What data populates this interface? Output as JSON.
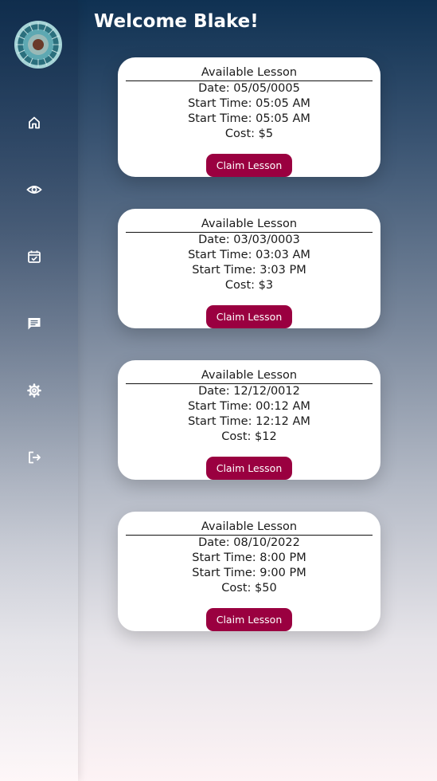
{
  "header": {
    "title": "Welcome Blake!"
  },
  "sidebar": {
    "items": [
      {
        "name": "home",
        "icon": "home-icon"
      },
      {
        "name": "view",
        "icon": "eye-icon"
      },
      {
        "name": "calendar",
        "icon": "calendar-check-icon"
      },
      {
        "name": "messages",
        "icon": "chat-icon"
      },
      {
        "name": "settings",
        "icon": "gear-icon"
      },
      {
        "name": "logout",
        "icon": "logout-icon"
      }
    ]
  },
  "colors": {
    "button": "#9a0040",
    "card": "#ffffff",
    "title": "#ffffff"
  },
  "lessons": [
    {
      "heading": "Available Lesson",
      "date": "Date: 05/05/0005",
      "start1": "Start Time: 05:05 AM",
      "start2": "Start Time: 05:05 AM",
      "cost": "Cost: $5",
      "button": "Claim Lesson"
    },
    {
      "heading": "Available Lesson",
      "date": "Date: 03/03/0003",
      "start1": "Start Time: 03:03 AM",
      "start2": "Start Time: 3:03 PM",
      "cost": "Cost: $3",
      "button": "Claim Lesson"
    },
    {
      "heading": "Available Lesson",
      "date": "Date: 12/12/0012",
      "start1": "Start Time: 00:12 AM",
      "start2": "Start Time: 12:12 AM",
      "cost": "Cost: $12",
      "button": "Claim Lesson"
    },
    {
      "heading": "Available Lesson",
      "date": "Date: 08/10/2022",
      "start1": "Start Time: 8:00 PM",
      "start2": "Start Time: 9:00 PM",
      "cost": "Cost: $50",
      "button": "Claim Lesson"
    }
  ]
}
